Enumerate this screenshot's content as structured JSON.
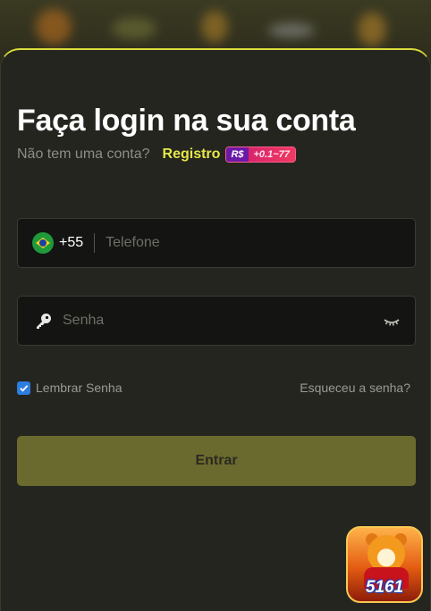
{
  "login": {
    "title": "Faça login na sua conta",
    "no_account_text": "Não tem uma conta?",
    "register_label": "Registro",
    "bonus": {
      "currency": "R$",
      "range": "+0.1~77"
    }
  },
  "phone": {
    "country_flag": "brazil-flag-icon",
    "dial_code": "+55",
    "placeholder": "Telefone",
    "value": ""
  },
  "password": {
    "placeholder": "Senha",
    "value": "",
    "icon": "key-icon",
    "toggle_icon": "eye-closed-icon"
  },
  "remember": {
    "label": "Lembrar Senha",
    "checked": true
  },
  "forgot_label": "Esqueceu a senha?",
  "submit_label": "Entrar",
  "app_icon": {
    "label": "5161"
  },
  "colors": {
    "accent": "#e6e64a",
    "button": "#6b6a2e",
    "sheet": "#252520",
    "checkbox": "#2e7de0"
  }
}
